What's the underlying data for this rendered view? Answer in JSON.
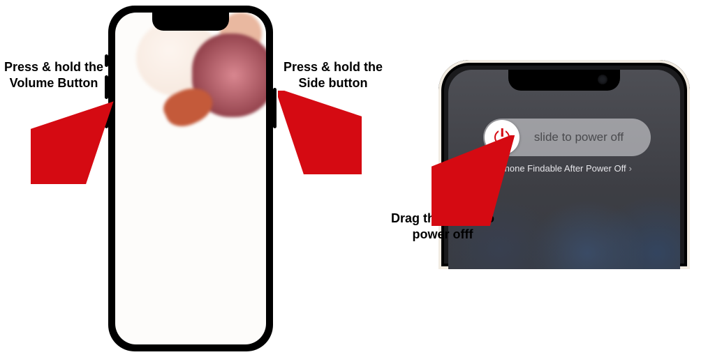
{
  "labels": {
    "volume": "Press & hold the Volume Button",
    "side": "Press & hold the Side button",
    "drag": "Drag the slider to power offf"
  },
  "phone2": {
    "slider_text": "slide to power off",
    "findable_text": "iPhone Findable After Power Off"
  },
  "colors": {
    "arrow": "#d50a12",
    "power_icon": "#d50a12"
  }
}
